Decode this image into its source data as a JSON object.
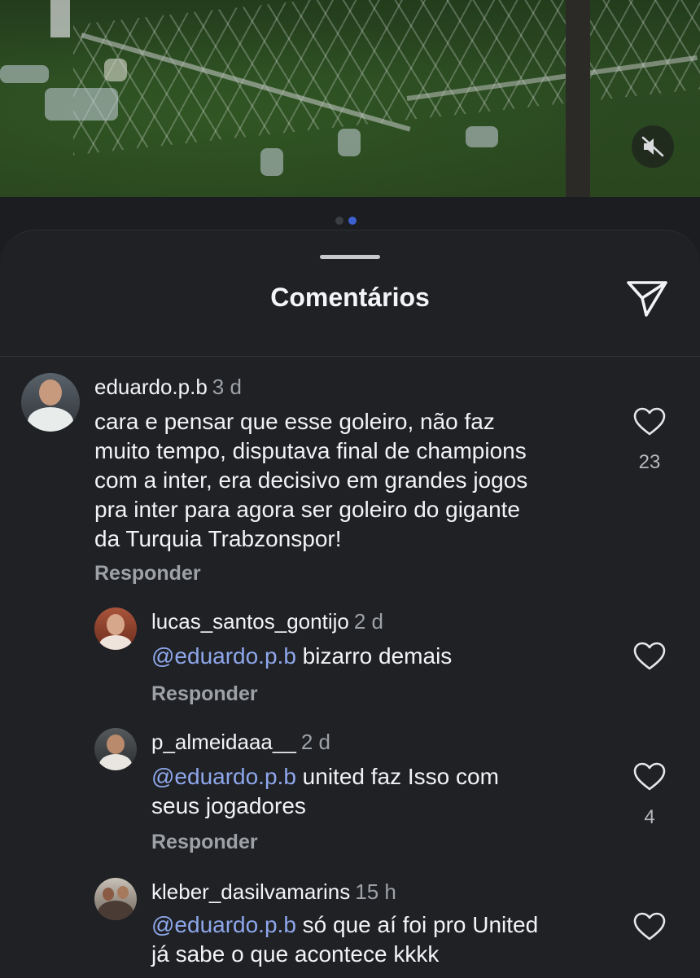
{
  "video": {
    "mute_icon": "speaker-muted-icon",
    "pager": {
      "count": 2,
      "active_index": 1
    }
  },
  "sheet": {
    "title": "Comentários",
    "share_icon": "paper-plane-icon"
  },
  "comments": [
    {
      "username": "eduardo.p.b",
      "time": "3 d",
      "mention": "",
      "text_lines": [
        "cara e pensar que esse goleiro, não faz",
        "muito tempo, disputava final de champions",
        "com a inter, era decisivo em grandes jogos",
        "pra inter para agora ser goleiro do gigante",
        "da Turquia Trabzonspor!"
      ],
      "likes": "23",
      "reply_label": "Responder"
    },
    {
      "username": "lucas_santos_gontijo",
      "time": "2 d",
      "mention": "@eduardo.p.b",
      "text": " bizarro demais",
      "likes": "",
      "reply_label": "Responder"
    },
    {
      "username": "p_almeidaaa__",
      "time": "2 d",
      "mention": "@eduardo.p.b",
      "text": " united faz Isso com",
      "text2": "seus jogadores",
      "likes": "4",
      "reply_label": "Responder"
    },
    {
      "username": "kleber_dasilvamarins",
      "time": "15 h",
      "mention": "@eduardo.p.b",
      "text": " só que aí foi pro United",
      "text2": "já sabe o que acontece kkkk",
      "likes": ""
    }
  ],
  "colors": {
    "background": "#1f2124",
    "mention": "#8ea7ec",
    "muted_text": "#9ea2a7",
    "active_dot": "#3d5fcf"
  }
}
